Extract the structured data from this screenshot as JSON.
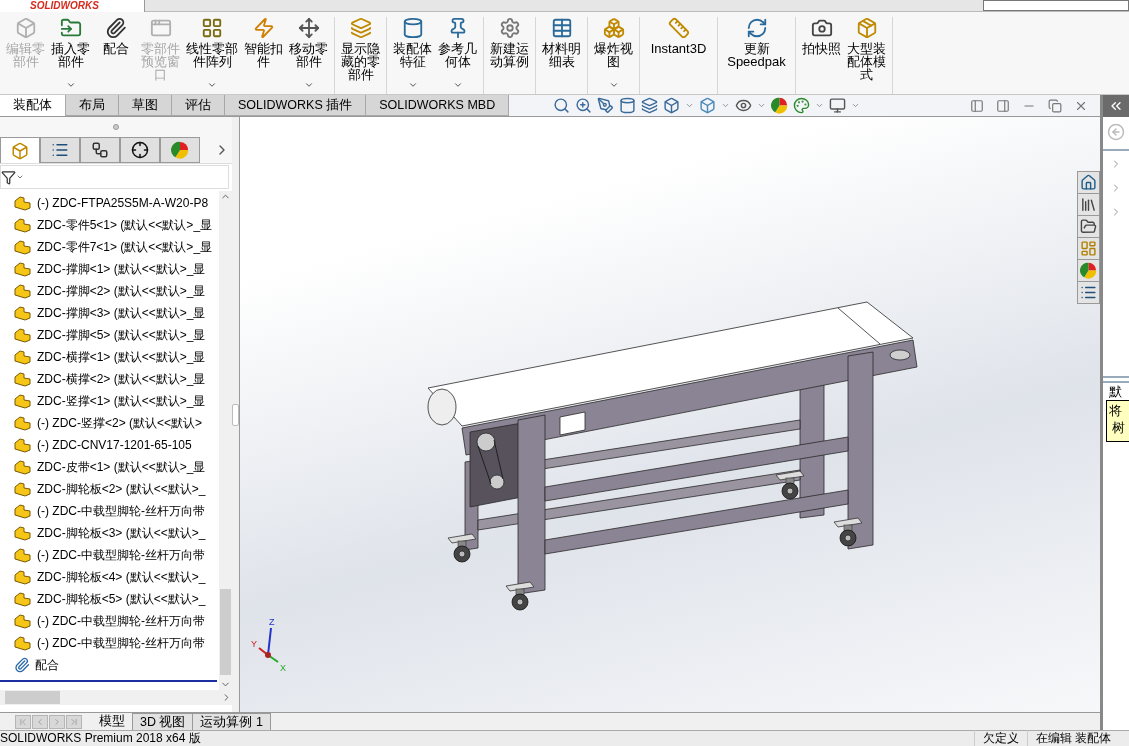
{
  "app_logo": "SOLIDWORKS",
  "ribbon": {
    "groups": [
      [
        {
          "kind": "edit_part",
          "label": "编辑零部件",
          "disabled": true,
          "dropdown": false
        },
        {
          "kind": "insert_part",
          "label": "插入零部件",
          "disabled": false,
          "dropdown": true
        },
        {
          "kind": "mate",
          "label": "配合",
          "disabled": false,
          "dropdown": false
        },
        {
          "kind": "preview",
          "label": "零部件预览窗口",
          "disabled": true,
          "dropdown": false
        },
        {
          "kind": "pattern",
          "label": "线性零部件阵列",
          "disabled": false,
          "dropdown": true
        },
        {
          "kind": "fastener",
          "label": "智能扣件",
          "disabled": false,
          "dropdown": false
        },
        {
          "kind": "move",
          "label": "移动零部件",
          "disabled": false,
          "dropdown": true
        }
      ],
      [
        {
          "kind": "show_hidden",
          "label": "显示隐藏的零部件",
          "disabled": false,
          "dropdown": false
        }
      ],
      [
        {
          "kind": "feature",
          "label": "装配体特征",
          "disabled": false,
          "dropdown": true
        },
        {
          "kind": "ref_geometry",
          "label": "参考几何体",
          "disabled": false,
          "dropdown": true
        }
      ],
      [
        {
          "kind": "motion",
          "label": "新建运动算例",
          "disabled": false,
          "dropdown": false
        }
      ],
      [
        {
          "kind": "bom",
          "label": "材料明细表",
          "disabled": false,
          "dropdown": false
        }
      ],
      [
        {
          "kind": "explode",
          "label": "爆炸视图",
          "disabled": false,
          "dropdown": true
        }
      ],
      [
        {
          "kind": "instant3d",
          "label": "Instant3D",
          "disabled": false,
          "dropdown": false
        }
      ],
      [
        {
          "kind": "speedpak",
          "label": "更新Speedpak",
          "disabled": false,
          "dropdown": false
        }
      ],
      [
        {
          "kind": "snapshot",
          "label": "拍快照",
          "disabled": false,
          "dropdown": false
        },
        {
          "kind": "large_assembly",
          "label": "大型装配体模式",
          "disabled": false,
          "dropdown": false
        }
      ]
    ]
  },
  "command_tabs": [
    {
      "label": "装配体",
      "selected": true
    },
    {
      "label": "布局",
      "selected": false
    },
    {
      "label": "草图",
      "selected": false
    },
    {
      "label": "评估",
      "selected": false
    },
    {
      "label": "SOLIDWORKS 插件",
      "selected": false
    },
    {
      "label": "SOLIDWORKS MBD",
      "selected": false
    }
  ],
  "panel_tabs": [
    {
      "kind": "tree",
      "selected": true
    },
    {
      "kind": "properties",
      "selected": false
    },
    {
      "kind": "configurations",
      "selected": false
    },
    {
      "kind": "dimensions",
      "selected": false
    },
    {
      "kind": "display",
      "selected": false
    }
  ],
  "feature_tree": [
    {
      "kind": "part",
      "label": "(-) ZDC-FTPA25S5M-A-W20-P8"
    },
    {
      "kind": "part",
      "label": "ZDC-零件5<1> (默认<<默认>_显"
    },
    {
      "kind": "part",
      "label": "ZDC-零件7<1> (默认<<默认>_显"
    },
    {
      "kind": "part",
      "label": "ZDC-撑脚<1> (默认<<默认>_显"
    },
    {
      "kind": "part",
      "label": "ZDC-撑脚<2> (默认<<默认>_显"
    },
    {
      "kind": "part",
      "label": "ZDC-撑脚<3> (默认<<默认>_显"
    },
    {
      "kind": "part",
      "label": "ZDC-撑脚<5> (默认<<默认>_显"
    },
    {
      "kind": "part",
      "label": "ZDC-横撑<1> (默认<<默认>_显"
    },
    {
      "kind": "part",
      "label": "ZDC-横撑<2> (默认<<默认>_显"
    },
    {
      "kind": "part",
      "label": "ZDC-竖撑<1> (默认<<默认>_显"
    },
    {
      "kind": "part",
      "label": "(-) ZDC-竖撑<2> (默认<<默认>"
    },
    {
      "kind": "part",
      "label": "(-) ZDC-CNV17-1201-65-105"
    },
    {
      "kind": "part",
      "label": "ZDC-皮带<1> (默认<<默认>_显"
    },
    {
      "kind": "part",
      "label": "ZDC-脚轮板<2> (默认<<默认>_"
    },
    {
      "kind": "part",
      "label": "(-) ZDC-中载型脚轮-丝杆万向带"
    },
    {
      "kind": "part",
      "label": "ZDC-脚轮板<3> (默认<<默认>_"
    },
    {
      "kind": "part",
      "label": "(-) ZDC-中载型脚轮-丝杆万向带"
    },
    {
      "kind": "part",
      "label": "ZDC-脚轮板<4> (默认<<默认>_"
    },
    {
      "kind": "part",
      "label": "ZDC-脚轮板<5> (默认<<默认>_"
    },
    {
      "kind": "part",
      "label": "(-) ZDC-中载型脚轮-丝杆万向带"
    },
    {
      "kind": "part",
      "label": "(-) ZDC-中载型脚轮-丝杆万向带"
    },
    {
      "kind": "mates",
      "label": "配合"
    }
  ],
  "document_tabs": [
    {
      "label": "模型",
      "selected": true
    },
    {
      "label": "3D 视图",
      "selected": false
    },
    {
      "label": "运动算例 1",
      "selected": false
    }
  ],
  "triad": {
    "x": "X",
    "y": "Y",
    "z": "Z"
  },
  "task_pane": {
    "heading": "默",
    "note_lines": [
      "将",
      "树"
    ]
  },
  "status_bar": {
    "product": "SOLIDWORKS Premium 2018 x64 版",
    "items": [
      "欠定义",
      "在编辑 装配体"
    ]
  }
}
